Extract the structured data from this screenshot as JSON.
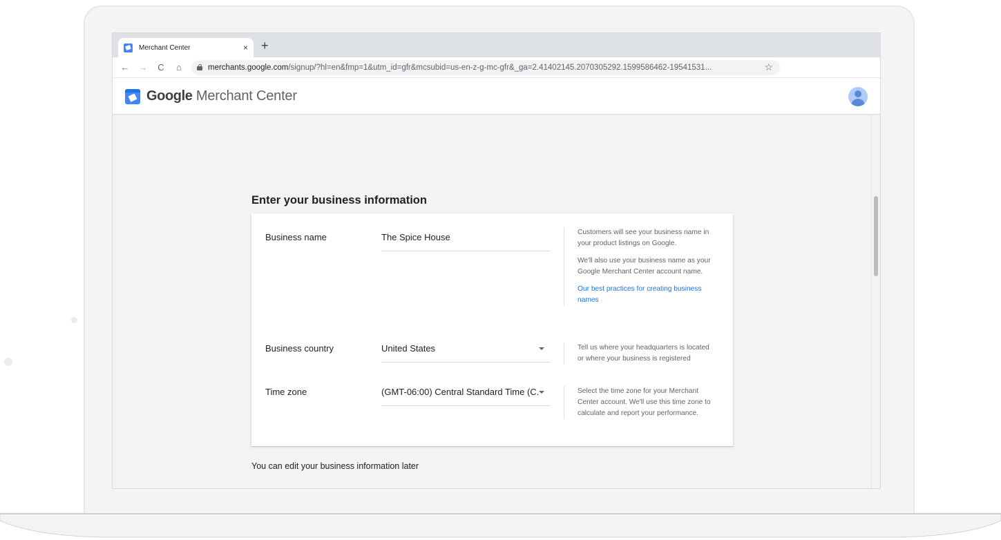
{
  "browser": {
    "tab_title": "Merchant Center",
    "tab_close": "×",
    "new_tab": "+",
    "url_host": "merchants.google.com",
    "url_path": "/signup/?hl=en&fmp=1&utm_id=gfr&mcsubid=us-en-z-g-mc-gfr&_ga=2.41402145.2070305292.1599586462-19541531...",
    "nav": {
      "back": "←",
      "forward": "→",
      "reload": "C",
      "home": "⌂"
    },
    "star": "☆"
  },
  "app": {
    "brand_google": "Google",
    "brand_product": " Merchant Center"
  },
  "form": {
    "title": "Enter your business information",
    "business_name": {
      "label": "Business name",
      "value": "The Spice House",
      "help": [
        "Customers will see your business name in your product listings on Google.",
        "We'll also use your business name as your Google Merchant Center account name."
      ],
      "help_link": "Our best practices for creating business names"
    },
    "business_country": {
      "label": "Business country",
      "value": "United States",
      "help": "Tell us where your headquarters is located or where your business is registered"
    },
    "time_zone": {
      "label": "Time zone",
      "value": "(GMT-06:00) Central Standard Time (C...",
      "help": "Select the time zone for your Merchant Center account. We'll use this time zone to calculate and report your performance."
    },
    "footnote": "You can edit your business information later"
  },
  "colors": {
    "accent": "#1a73e8",
    "background": "#f1f3f4",
    "text": "#202124",
    "secondary_text": "#5f6368"
  }
}
